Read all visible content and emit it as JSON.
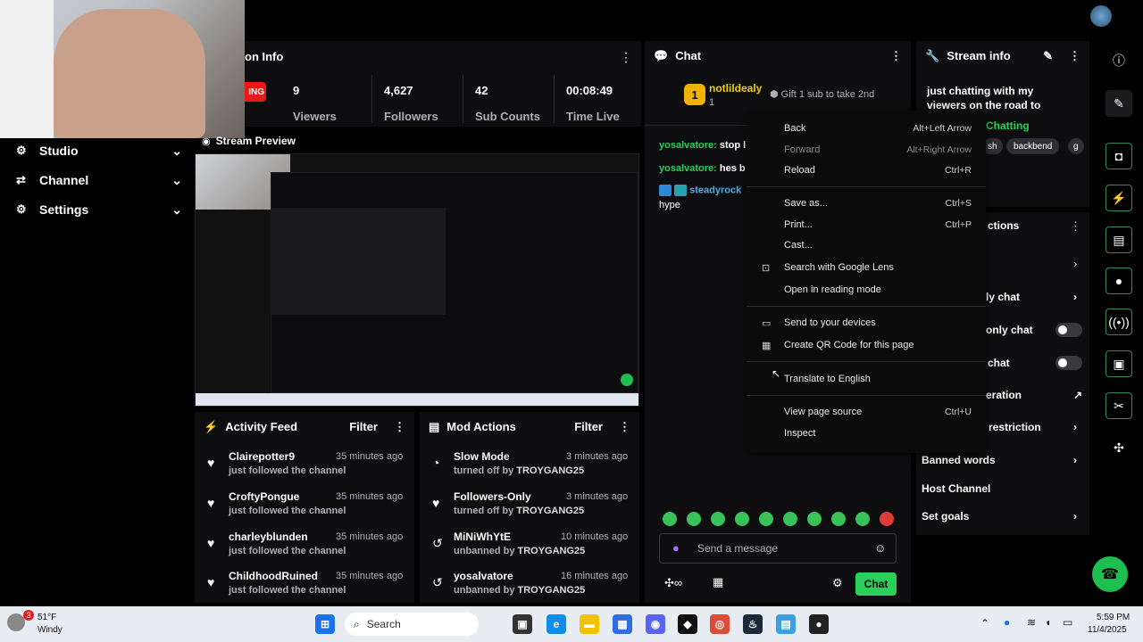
{
  "stream_info_header": {
    "title_partial": "on Info",
    "live_badge_partial": "ING"
  },
  "stats": [
    {
      "value": "9",
      "label": "Viewers"
    },
    {
      "value": "4,627",
      "label": "Followers"
    },
    {
      "value": "42",
      "label": "Sub Counts"
    },
    {
      "value": "00:08:49",
      "label": "Time Live"
    }
  ],
  "sidebar": {
    "items": [
      {
        "label": "Studio",
        "icon": "gear-icon"
      },
      {
        "label": "Channel",
        "icon": "channel-icon"
      },
      {
        "label": "Settings",
        "icon": "settings-icon"
      }
    ]
  },
  "preview": {
    "title": "Stream Preview"
  },
  "activity_feed": {
    "title": "Activity Feed",
    "filter": "Filter",
    "rows": [
      {
        "name": "Clairepotter9",
        "sub": "just followed the channel",
        "time": "35 minutes ago"
      },
      {
        "name": "CroftyPongue",
        "sub": "just followed the channel",
        "time": "35 minutes ago"
      },
      {
        "name": "charleyblunden",
        "sub": "just followed the channel",
        "time": "35 minutes ago"
      },
      {
        "name": "ChildhoodRuined",
        "sub": "just followed the channel",
        "time": "35 minutes ago"
      }
    ]
  },
  "mod_actions": {
    "title": "Mod Actions",
    "filter": "Filter",
    "rows": [
      {
        "name": "Slow Mode",
        "sub_prefix": "turned off by ",
        "by": "TROYGANG25",
        "time": "3 minutes ago"
      },
      {
        "name": "Followers-Only",
        "sub_prefix": "turned off by ",
        "by": "TROYGANG25",
        "time": "3 minutes ago"
      },
      {
        "name": "MiNiWhYtE",
        "sub_prefix": "unbanned by ",
        "by": "TROYGANG25",
        "time": "10 minutes ago"
      },
      {
        "name": "yosalvatore",
        "sub_prefix": "unbanned by ",
        "by": "TROYGANG25",
        "time": "16 minutes ago"
      }
    ]
  },
  "chat": {
    "title": "Chat",
    "top_gifter": {
      "rank": "1",
      "name": "notlildealy",
      "count": "1"
    },
    "gift_text": "Gift 1 sub to take 2nd",
    "messages": [
      {
        "user": "yosalvatore:",
        "text": " stop l"
      },
      {
        "user": "yosalvatore:",
        "text": " hes b"
      },
      {
        "user": "steadyrock",
        "text": ""
      }
    ],
    "hype": "hype",
    "input_placeholder": "Send a message",
    "send_label": "Chat"
  },
  "stream_info_panel": {
    "title": "Stream info",
    "description": "just chatting with my viewers on the road to partner",
    "category": "Chatting",
    "tags": [
      "sh",
      "backbend",
      "g"
    ]
  },
  "chat_actions": {
    "title_partial": "ctions",
    "rows": [
      {
        "label": "ly chat"
      },
      {
        "label": "only chat"
      },
      {
        "label": "chat"
      },
      {
        "label": "eration"
      },
      {
        "label": "restriction"
      },
      {
        "label": "Banned words"
      },
      {
        "label": "Host Channel"
      },
      {
        "label": "Set goals"
      }
    ]
  },
  "context_menu": {
    "items": [
      {
        "label": "Back",
        "shortcut": "Alt+Left Arrow"
      },
      {
        "label": "Forward",
        "shortcut": "Alt+Right Arrow"
      },
      {
        "label": "Reload",
        "shortcut": "Ctrl+R"
      },
      {
        "label": "Save as...",
        "shortcut": "Ctrl+S"
      },
      {
        "label": "Print...",
        "shortcut": "Ctrl+P"
      },
      {
        "label": "Cast...",
        "shortcut": ""
      },
      {
        "label": "Search with Google Lens",
        "shortcut": ""
      },
      {
        "label": "Open in reading mode",
        "shortcut": ""
      },
      {
        "label": "Send to your devices",
        "shortcut": ""
      },
      {
        "label": "Create QR Code for this page",
        "shortcut": ""
      },
      {
        "label": "Translate to English",
        "shortcut": ""
      },
      {
        "label": "View page source",
        "shortcut": "Ctrl+U"
      },
      {
        "label": "Inspect",
        "shortcut": ""
      }
    ]
  },
  "taskbar": {
    "weather_temp": "51°F",
    "weather_desc": "Windy",
    "weather_badge": "3",
    "search_label": "Search",
    "time": "5:59 PM",
    "date": "11/4/2025"
  },
  "colors": {
    "accent_green": "#00c853",
    "live_red": "#e91916",
    "panel_bg": "#0e0e10",
    "taskbar_bg": "#e8edf4"
  }
}
